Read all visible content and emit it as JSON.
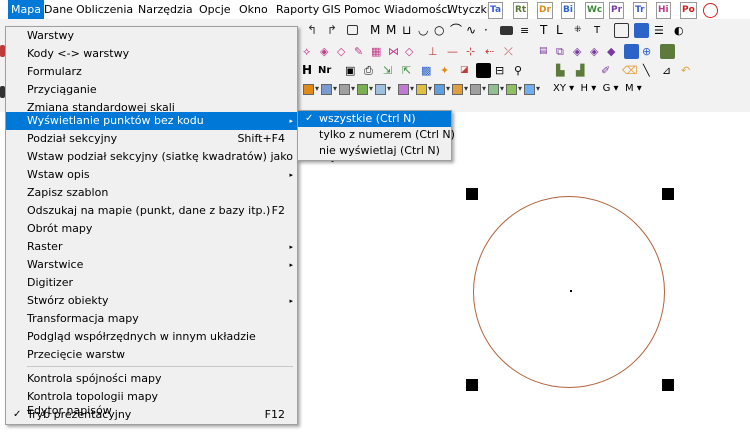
{
  "menubar": {
    "items": [
      "Mapa",
      "Dane",
      "Obliczenia",
      "Narzędzia",
      "Opcje",
      "Okno",
      "Raporty",
      "GIS",
      "Pomoc",
      "Wiadomości",
      "Wtyczki"
    ],
    "active_index": 0
  },
  "toolbar": {
    "text_icons": [
      "Ta",
      "Rt",
      "Dr",
      "Bi",
      "Wc",
      "Pr",
      "Tr",
      "Hi",
      "Po"
    ],
    "text_icon_colors": [
      "#3a5bd9",
      "#5c7a3a",
      "#e08a1a",
      "#2b63c8",
      "#3a8a3a",
      "#7a3aa0",
      "#3a5bd9",
      "#c03a8a",
      "#d02020"
    ],
    "nr_label": "Nr",
    "xy_items": [
      "XY",
      "H",
      "G",
      "M"
    ],
    "dropdown_colors": [
      "#e08a1a",
      "#7a9ad0",
      "#a0a0a0",
      "#7ab050",
      "#a0c0e0",
      "#c07ad0",
      "#e0c040",
      "#60a0e0",
      "#e0a040",
      "#a0a0a0",
      "#90c090",
      "#90c060",
      "#70b0f0"
    ]
  },
  "menu": {
    "items": [
      {
        "label": "Warstwy"
      },
      {
        "label": "Kody <-> warstwy"
      },
      {
        "label": "Formularz"
      },
      {
        "label": "Przyciąganie"
      },
      {
        "label": "Zmiana standardowej skali"
      },
      {
        "label": "Wyświetlanie punktów bez kodu",
        "submenu": true,
        "highlighted": true
      },
      {
        "label": "Podział sekcyjny",
        "shortcut": "Shift+F4"
      },
      {
        "label": "Wstaw podział sekcyjny (siatkę kwadratów) jako obiekty"
      },
      {
        "label": "Wstaw opis",
        "submenu": true
      },
      {
        "label": "Zapisz szablon"
      },
      {
        "label": "Odszukaj na mapie (punkt, dane z bazy itp.)",
        "shortcut": "F2"
      },
      {
        "label": "Obrót mapy"
      },
      {
        "label": "Raster",
        "submenu": true
      },
      {
        "label": "Warstwice",
        "submenu": true
      },
      {
        "label": "Digitizer"
      },
      {
        "label": "Stwórz obiekty",
        "submenu": true
      },
      {
        "label": "Transformacja mapy"
      },
      {
        "label": "Podgląd współrzędnych w innym układzie"
      },
      {
        "label": "Przecięcie warstw"
      },
      {
        "label": "Kontrola spójności mapy"
      },
      {
        "label": "Kontrola topologii mapy"
      },
      {
        "label": "Tryb prezentacyjny",
        "shortcut": "F12",
        "checked": true
      },
      {
        "label": "Edytor napisów"
      }
    ],
    "check_glyph": "✓",
    "submenu_glyph": "▸"
  },
  "submenu": {
    "items": [
      {
        "label": "wszystkie (Ctrl N)",
        "checked": true,
        "highlighted": true
      },
      {
        "label": "tylko z numerem (Ctrl N)"
      },
      {
        "label": "nie wyświetlaj (Ctrl N)"
      }
    ]
  },
  "colors": {
    "highlight": "#0078d7",
    "circle_stroke": "#b0643c"
  }
}
